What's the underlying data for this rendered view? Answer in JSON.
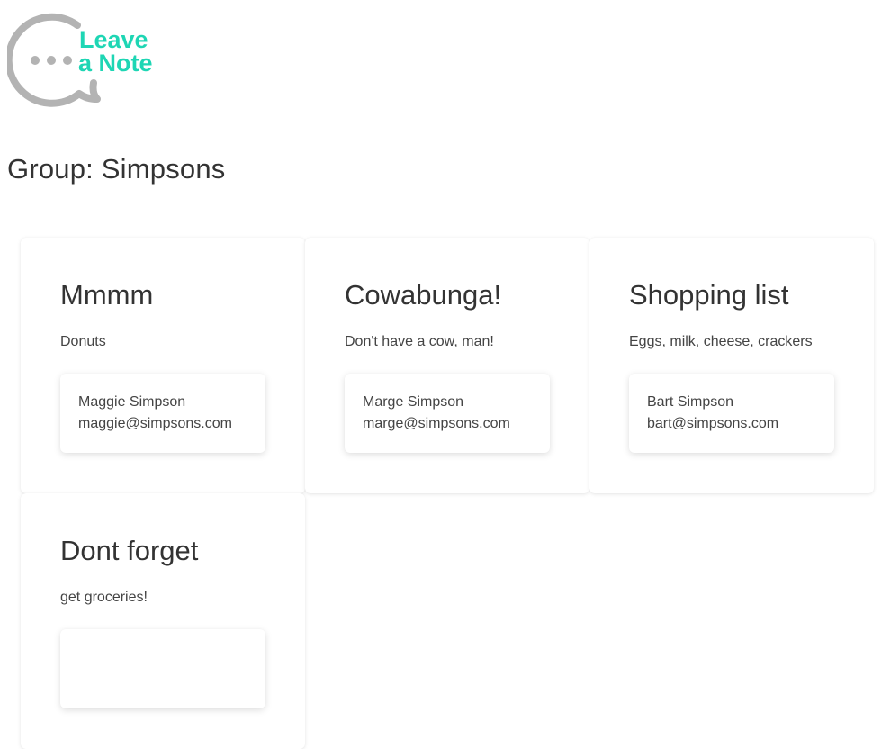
{
  "logo": {
    "line1": "Leave",
    "line2": "a Note",
    "accent_color": "#1ed6b4",
    "bubble_color": "#b3b3b3"
  },
  "group": {
    "title": "Group: Simpsons"
  },
  "notes": [
    {
      "title": "Mmmm",
      "body": "Donuts",
      "author_name": "Maggie Simpson",
      "author_email": "maggie@simpsons.com"
    },
    {
      "title": "Cowabunga!",
      "body": "Don't have a cow, man!",
      "author_name": "Marge Simpson",
      "author_email": "marge@simpsons.com"
    },
    {
      "title": "Shopping list",
      "body": "Eggs, milk, cheese, crackers",
      "author_name": "Bart Simpson",
      "author_email": "bart@simpsons.com"
    },
    {
      "title": "Dont forget",
      "body": "get groceries!",
      "author_name": "",
      "author_email": ""
    }
  ]
}
